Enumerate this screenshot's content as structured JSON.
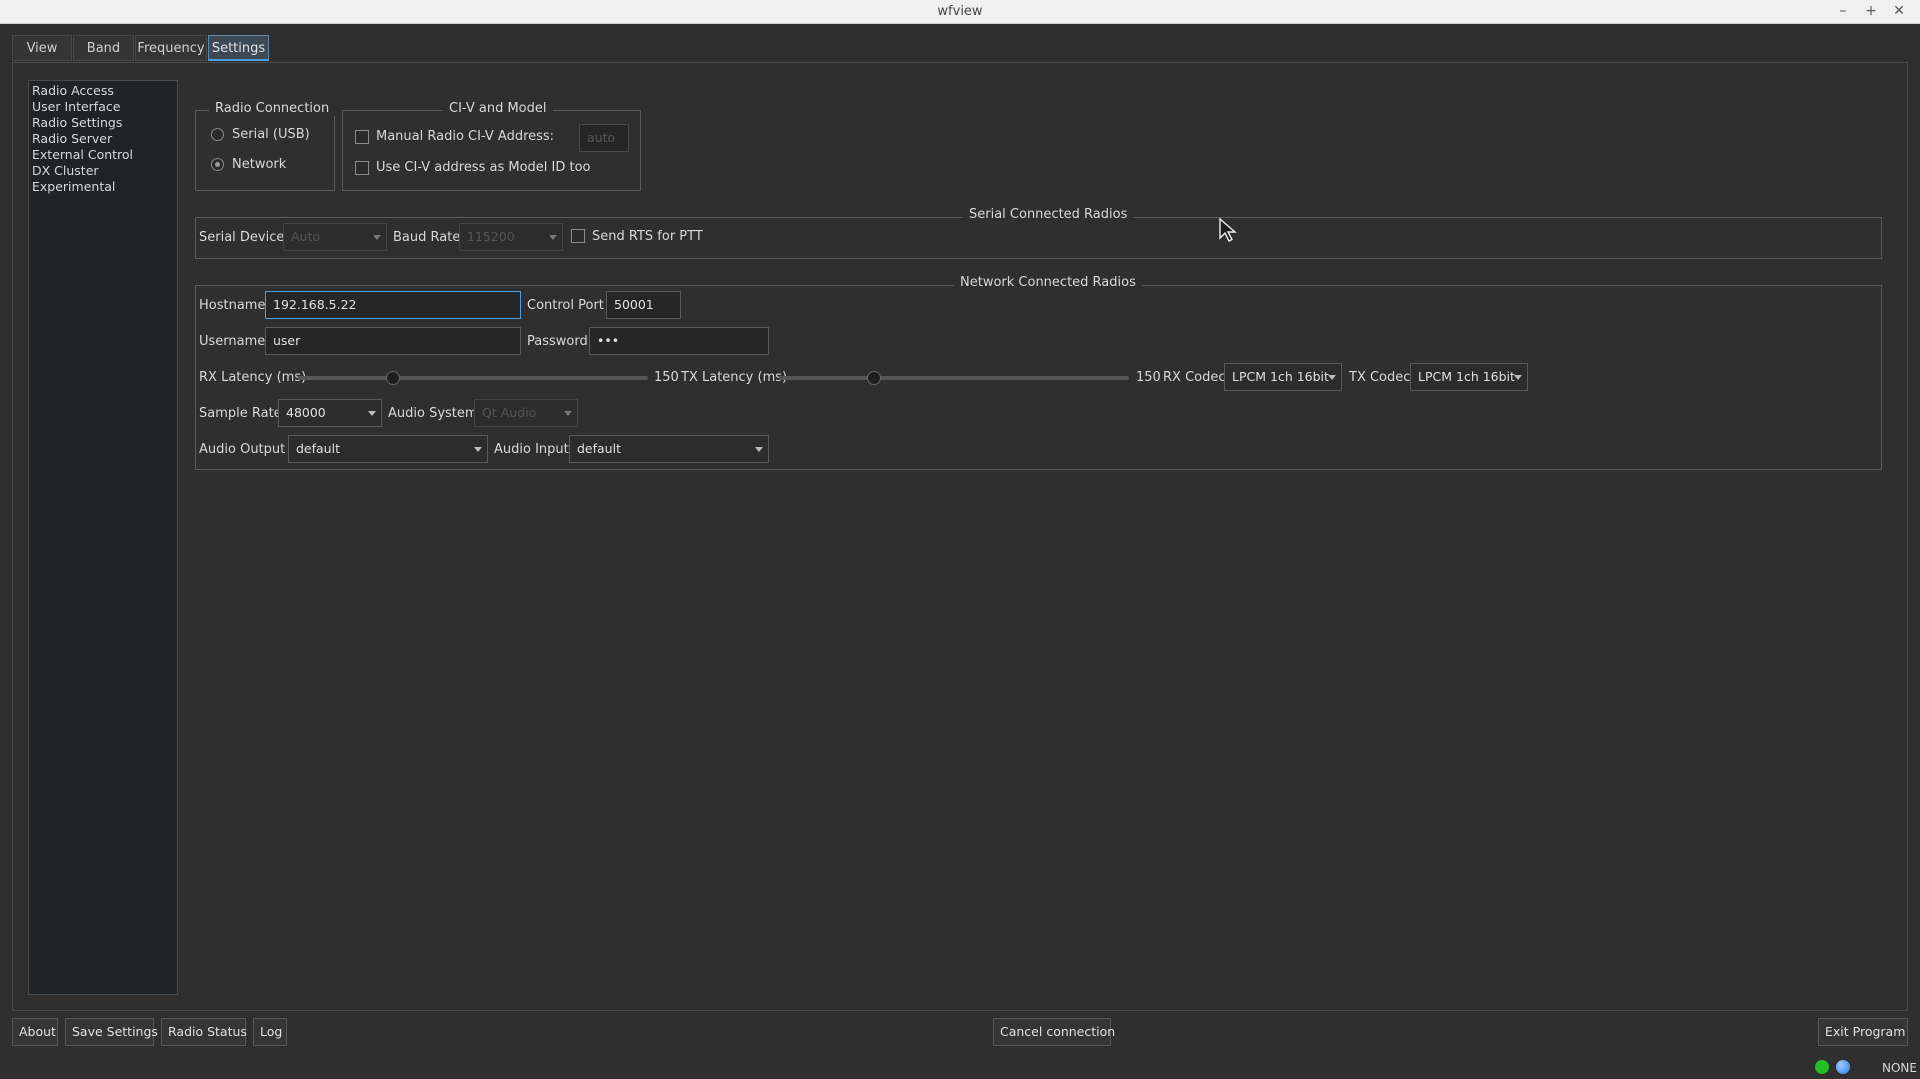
{
  "window": {
    "title": "wfview"
  },
  "tabs": [
    {
      "label": "View"
    },
    {
      "label": "Band"
    },
    {
      "label": "Frequency"
    },
    {
      "label": "Settings"
    }
  ],
  "sidebar": {
    "items": [
      {
        "label": "Radio Access"
      },
      {
        "label": "User Interface"
      },
      {
        "label": "Radio Settings"
      },
      {
        "label": "Radio Server"
      },
      {
        "label": "External Control"
      },
      {
        "label": "DX Cluster"
      },
      {
        "label": "Experimental"
      }
    ]
  },
  "radio_connection": {
    "title": "Radio Connection",
    "serial_label": "Serial (USB)",
    "network_label": "Network",
    "selected": "Network"
  },
  "civ_model": {
    "title": "CI-V and Model",
    "manual_label": "Manual Radio CI-V Address:",
    "manual_checked": false,
    "address_placeholder": "auto",
    "model_id_label": "Use CI-V address as Model ID too",
    "model_id_checked": false
  },
  "serial_radios": {
    "title": "Serial Connected Radios",
    "device_label": "Serial Device:",
    "device_value": "Auto",
    "baud_label": "Baud Rate",
    "baud_value": "115200",
    "rts_label": "Send RTS for PTT",
    "rts_checked": false
  },
  "network_radios": {
    "title": "Network Connected Radios",
    "hostname_label": "Hostname",
    "hostname_value": "192.168.5.22",
    "control_port_label": "Control Port",
    "control_port_value": "50001",
    "username_label": "Username",
    "username_value": "user",
    "password_label": "Password",
    "password_value": "•••",
    "rx_latency_label": "RX Latency (ms)",
    "rx_latency_value": "150",
    "rx_latency_fraction": 0.27,
    "tx_latency_label": "TX Latency (ms)",
    "tx_latency_value": "150",
    "tx_latency_fraction": 0.27,
    "rx_codec_label": "RX Codec",
    "rx_codec_value": "LPCM 1ch 16bit",
    "tx_codec_label": "TX Codec",
    "tx_codec_value": "LPCM 1ch 16bit",
    "sample_rate_label": "Sample Rate",
    "sample_rate_value": "48000",
    "audio_system_label": "Audio System",
    "audio_system_value": "Qt Audio",
    "audio_output_label": "Audio Output",
    "audio_output_value": "default",
    "audio_input_label": "Audio Input",
    "audio_input_value": "default"
  },
  "footer": {
    "about": "About",
    "save_settings": "Save Settings",
    "radio_status": "Radio Status",
    "log": "Log",
    "cancel_connection": "Cancel connection",
    "exit_program": "Exit Program"
  },
  "statusbar": {
    "mode_text": "NONE",
    "indicator1_color": "#22c022",
    "indicator2_color": "#2d7fe0"
  }
}
